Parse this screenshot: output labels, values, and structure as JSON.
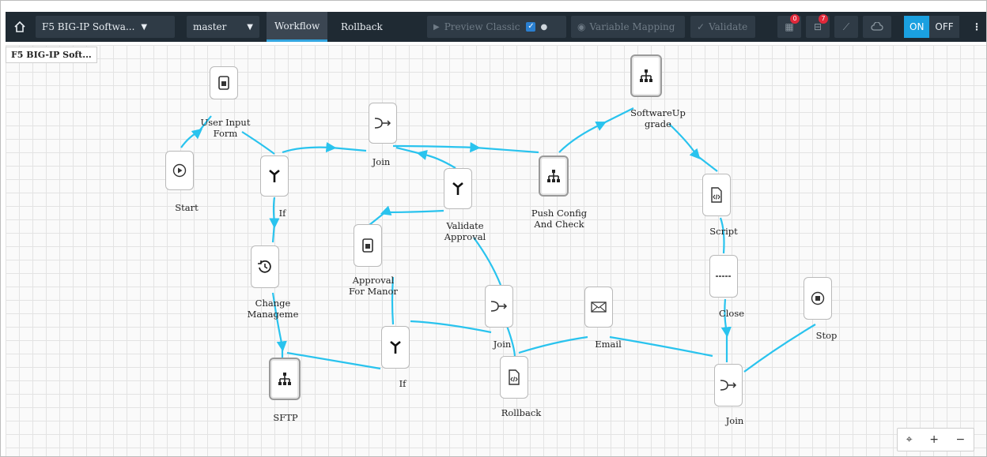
{
  "toolbar": {
    "workflow_select": "F5 BIG-IP Softwa...",
    "branch_select": "master",
    "tabs": [
      {
        "label": "Workflow",
        "active": true
      },
      {
        "label": "Rollback",
        "active": false
      }
    ],
    "preview_label": "Preview Classic",
    "variable_mapping_label": "Variable Mapping",
    "validate_label": "Validate",
    "badge_count_1": "0",
    "badge_count_2": "7",
    "toggle_on": "ON",
    "toggle_off": "OFF",
    "accent_color": "#1aa0e0",
    "active_tab_underline": "#34a6e0"
  },
  "canvas": {
    "workflow_name": "F5 BIG-IP Soft...",
    "edge_color": "#29c3ee",
    "nodes": [
      {
        "id": "user-input-form",
        "label": "User Input\nForm",
        "icon": "form-icon"
      },
      {
        "id": "start",
        "label": "Start",
        "icon": "play-circle-icon"
      },
      {
        "id": "if-1",
        "label": "If",
        "icon": "branch-icon"
      },
      {
        "id": "join-1",
        "label": "Join",
        "icon": "join-icon"
      },
      {
        "id": "validate-approval",
        "label": "Validate\nApproval",
        "icon": "branch-icon"
      },
      {
        "id": "push-config",
        "label": "Push Config\nAnd Check",
        "icon": "sitemap-icon"
      },
      {
        "id": "software-upgrade",
        "label": "SoftwareUp\ngrade",
        "icon": "sitemap-icon"
      },
      {
        "id": "script-1",
        "label": "Script",
        "icon": "code-file-icon"
      },
      {
        "id": "change-management",
        "label": "Change\nManageme",
        "icon": "history-icon"
      },
      {
        "id": "approval-for-manor",
        "label": "Approval\nFor Manor",
        "icon": "form-icon"
      },
      {
        "id": "join-2",
        "label": "Join",
        "icon": "join-icon"
      },
      {
        "id": "email",
        "label": "Email",
        "icon": "email-icon"
      },
      {
        "id": "close",
        "label": "Close",
        "icon": "dash-icon"
      },
      {
        "id": "stop",
        "label": "Stop",
        "icon": "stop-circle-icon"
      },
      {
        "id": "sftp",
        "label": "SFTP",
        "icon": "sitemap-icon"
      },
      {
        "id": "if-2",
        "label": "If",
        "icon": "branch-icon"
      },
      {
        "id": "rollback",
        "label": "Rollback",
        "icon": "code-file-icon"
      },
      {
        "id": "join-3",
        "label": "Join",
        "icon": "join-icon"
      }
    ]
  },
  "zoom_controls": {
    "fit_symbol": "⌖",
    "zoom_in_symbol": "+",
    "zoom_out_symbol": "−"
  }
}
